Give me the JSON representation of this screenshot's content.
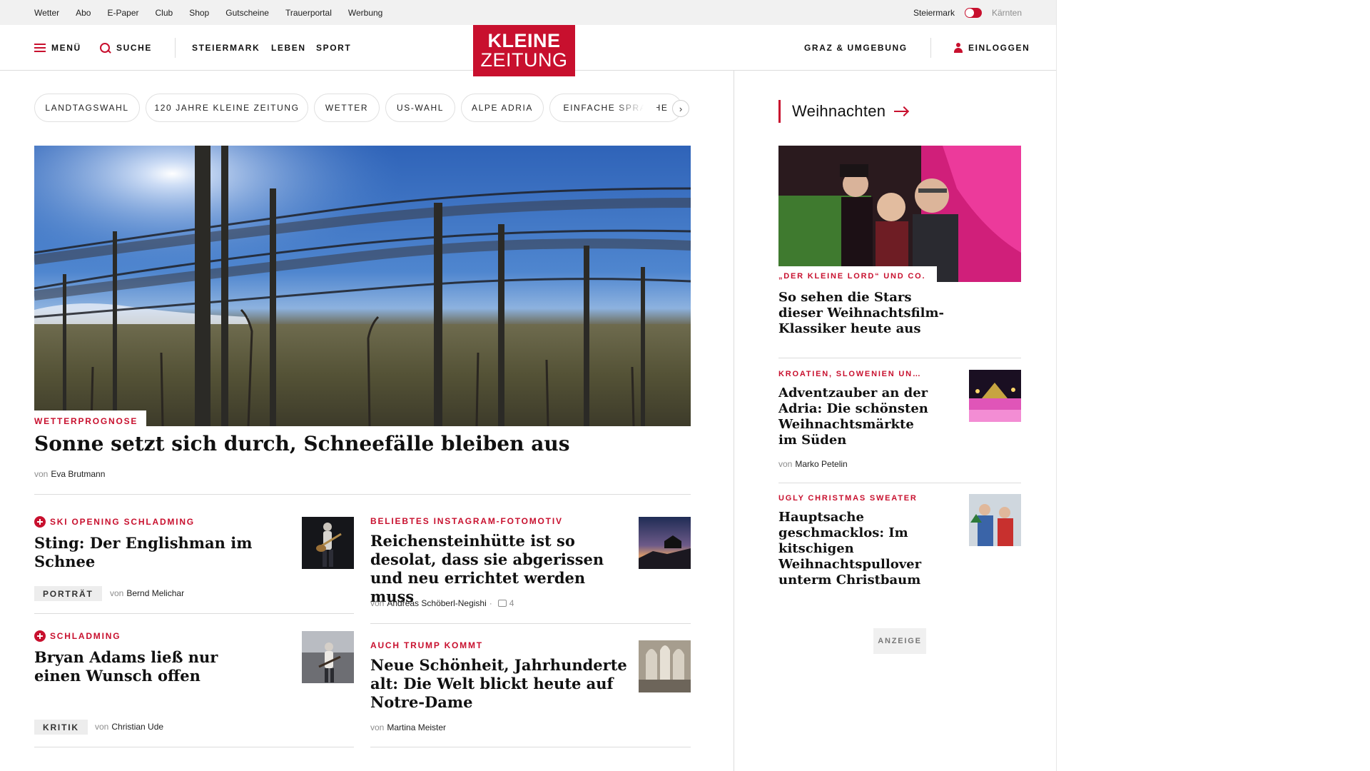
{
  "utility_bar": {
    "links": [
      "Wetter",
      "Abo",
      "E-Paper",
      "Club",
      "Shop",
      "Gutscheine",
      "Trauerportal",
      "Werbung"
    ],
    "region_active": "Steiermark",
    "region_inactive": "Kärnten"
  },
  "nav": {
    "menu": "MENÜ",
    "search": "SUCHE",
    "sections": [
      "STEIERMARK",
      "LEBEN",
      "SPORT"
    ],
    "logo_line1": "KLEINE",
    "logo_line2": "ZEITUNG",
    "local": "GRAZ & UMGEBUNG",
    "login": "EINLOGGEN"
  },
  "topics": [
    "LANDTAGSWAHL",
    "120 JAHRE KLEINE ZEITUNG",
    "WETTER",
    "US-WAHL",
    "ALPE ADRIA",
    "EINFACHE SPRACHE"
  ],
  "hero": {
    "kicker": "WETTERPROGNOSE",
    "title": "Sonne setzt sich durch, Schneefälle bleiben aus",
    "by_prefix": "von",
    "author": "Eva Brutmann"
  },
  "teasers": [
    {
      "kicker": "SKI OPENING SCHLADMING",
      "premium": true,
      "title": "Sting: Der Englishman im Schnee",
      "badge": "PORTRÄT",
      "by_prefix": "von",
      "author": "Bernd Melichar",
      "thumb_icon": "guitarist-photo"
    },
    {
      "kicker": "BELIEBTES INSTAGRAM-FOTOMOTIV",
      "premium": false,
      "title": "Reichensteinhütte ist so desolat, dass sie abgerissen und neu errichtet werden muss",
      "by_prefix": "von",
      "author": "Andreas Schöberl-Negishi",
      "separator": "·",
      "comments": "4",
      "thumb_icon": "mountain-hut-photo"
    },
    {
      "kicker": "SCHLADMING",
      "premium": true,
      "title": "Bryan Adams ließ nur einen Wunsch offen",
      "badge": "KRITIK",
      "by_prefix": "von",
      "author": "Christian Ude",
      "thumb_icon": "concert-photo"
    },
    {
      "kicker": "AUCH TRUMP KOMMT",
      "premium": false,
      "title": "Neue Schönheit, Jahrhunderte alt: Die Welt blickt heute auf Notre-Dame",
      "by_prefix": "von",
      "author": "Martina Meister",
      "thumb_icon": "cathedral-interior-photo"
    }
  ],
  "sidebar": {
    "section_title": "Weihnachten",
    "lead": {
      "kicker": "„DER KLEINE LORD“ UND CO.",
      "title": "So sehen die Stars dieser Weihnachtsfilm-Klassiker heute aus"
    },
    "items": [
      {
        "kicker": "KROATIEN, SLOWENIEN UN…",
        "title": "Adventzauber an der Adria: Die schönsten Weihnachtsmärkte im Süden",
        "by_prefix": "von",
        "author": "Marko Petelin"
      },
      {
        "kicker": "UGLY CHRISTMAS SWEATER",
        "title": "Hauptsache geschmacklos: Im kitschigen Weihnachtspullover unterm Christbaum"
      }
    ],
    "ad_label": "ANZEIGE"
  },
  "colors": {
    "brand_red": "#c8102e",
    "divider": "#dcdcdc",
    "utility_bg": "#f1f1f1"
  }
}
